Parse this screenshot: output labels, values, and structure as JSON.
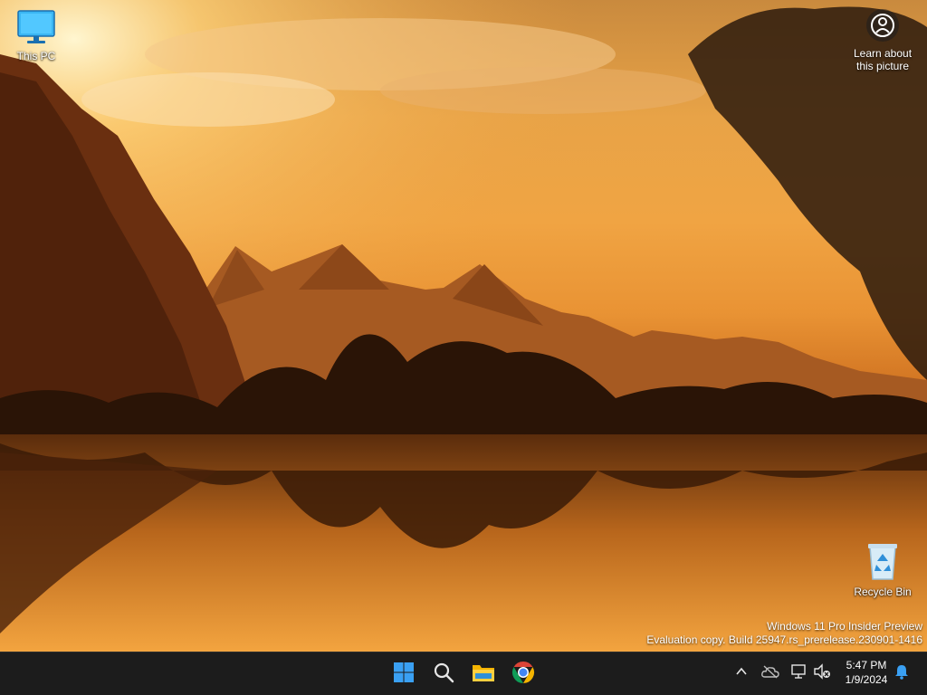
{
  "desktop": {
    "icons": [
      {
        "label": "This PC",
        "icon": "monitor-icon"
      },
      {
        "label": "Recycle Bin",
        "icon": "recycle-bin-icon"
      }
    ],
    "spotlight": {
      "line1": "Learn about",
      "line2": "this picture",
      "icon": "camera-circle-icon"
    },
    "watermark": {
      "line1": "Windows 11 Pro Insider Preview",
      "line2": "Evaluation copy. Build 25947.rs_prerelease.230901-1416"
    }
  },
  "taskbar": {
    "apps": [
      {
        "name": "Start",
        "icon": "windows-logo-icon"
      },
      {
        "name": "Search",
        "icon": "search-icon"
      },
      {
        "name": "File Explorer",
        "icon": "folder-icon"
      },
      {
        "name": "Google Chrome",
        "icon": "chrome-icon"
      }
    ],
    "tray": {
      "time": "5:47 PM",
      "date": "1/9/2024",
      "icons": [
        "chevron-up-icon",
        "onedrive-offline-icon",
        "network-icon",
        "volume-muted-icon",
        "notification-bell-icon"
      ]
    },
    "colors": {
      "background": "#1c1c1c",
      "accent": "#3aa0f3"
    }
  }
}
